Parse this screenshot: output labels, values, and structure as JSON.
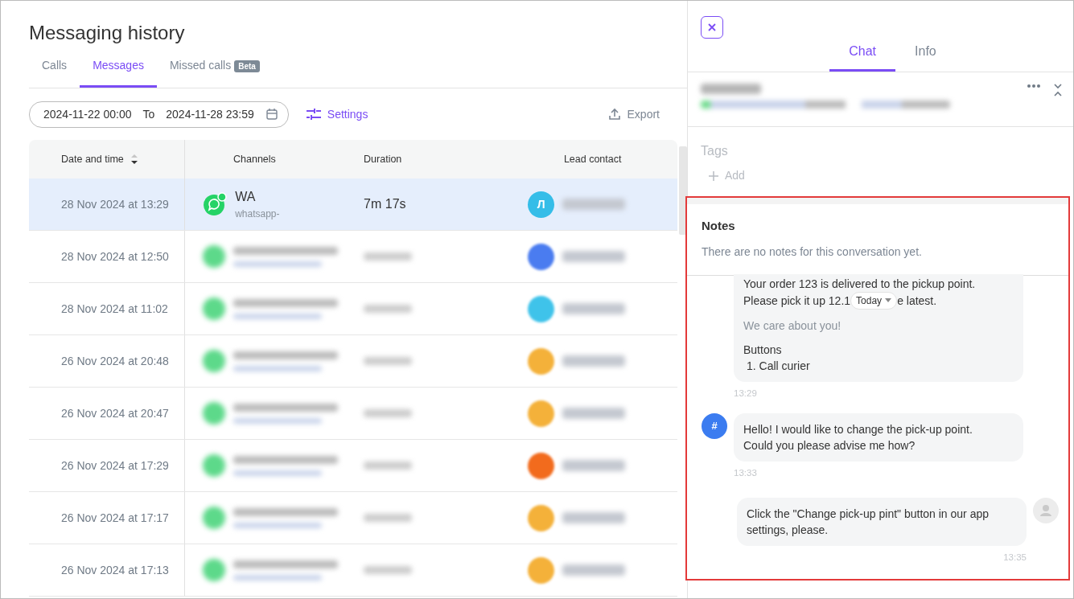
{
  "page_title": "Messaging history",
  "tabs": [
    {
      "label": "Calls",
      "selected": false
    },
    {
      "label": "Messages",
      "selected": true
    },
    {
      "label": "Missed calls",
      "selected": false,
      "badge": "Beta"
    }
  ],
  "filter": {
    "date_from": "2024-11-22 00:00",
    "separator": "To",
    "date_to": "2024-11-28 23:59",
    "settings": "Settings",
    "export": "Export"
  },
  "table": {
    "columns": [
      "Date and time",
      "Channels",
      "Duration",
      "Lead contact"
    ],
    "rows": [
      {
        "date": "28 Nov 2024 at 13:29",
        "selected": true,
        "channel": "WA",
        "channel_sub": "whatsapp-",
        "duration": "7m 17s",
        "avatar": "Л",
        "color": "#35bde8"
      },
      {
        "date": "28 Nov 2024 at 12:50",
        "selected": false,
        "color": "#4a7cf0"
      },
      {
        "date": "28 Nov 2024 at 11:02",
        "selected": false,
        "color": "#3fc3ea"
      },
      {
        "date": "26 Nov 2024 at 20:48",
        "selected": false,
        "color": "#f4b13a"
      },
      {
        "date": "26 Nov 2024 at 20:47",
        "selected": false,
        "color": "#f4b13a"
      },
      {
        "date": "26 Nov 2024 at 17:29",
        "selected": false,
        "color": "#f26b1d"
      },
      {
        "date": "26 Nov 2024 at 17:17",
        "selected": false,
        "color": "#f4b13a"
      },
      {
        "date": "26 Nov 2024 at 17:13",
        "selected": false,
        "color": "#f4b13a"
      }
    ]
  },
  "panel": {
    "tabs": [
      {
        "label": "Chat",
        "selected": true
      },
      {
        "label": "Info",
        "selected": false
      }
    ],
    "tags_label": "Tags",
    "add_tag": "Add",
    "notes": {
      "title": "Notes",
      "empty": "There are no notes for this conversation yet."
    },
    "messages": [
      {
        "kind": "template",
        "line1": "Your order 123 is delivered to the pickup point.",
        "line2_start": "Please pick it up 12.1",
        "date_pill": "Today",
        "line2_end": "e latest.",
        "footer": "We care about you!",
        "buttons_title": "Buttons",
        "buttons": [
          "1. Call curier"
        ],
        "time": "13:29"
      },
      {
        "kind": "incoming",
        "avatar": "#",
        "text": "Hello! I would like to change the pick-up point.\nCould you please advise me how?",
        "time": "13:33"
      },
      {
        "kind": "outgoing",
        "text": "Click the \"Change pick-up pint\" button in our app settings, please.",
        "time": "13:35"
      }
    ]
  }
}
